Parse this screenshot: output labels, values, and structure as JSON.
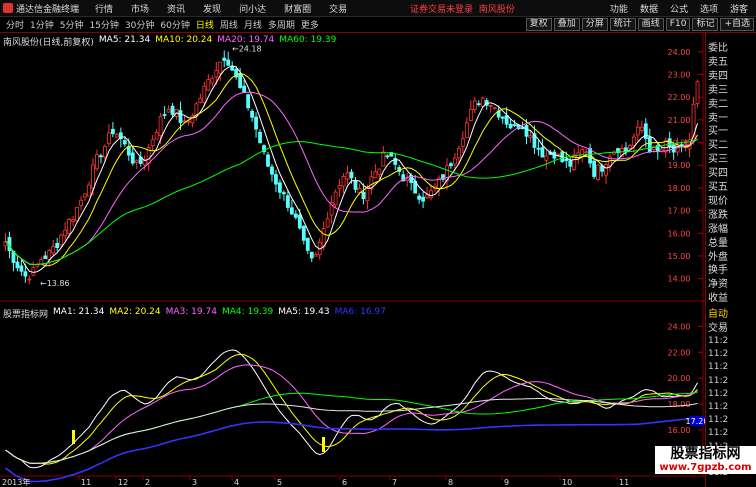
{
  "app": {
    "title": "通达信金融终端"
  },
  "menu": [
    "行情",
    "市场",
    "资讯",
    "发现",
    "问小达",
    "财富圈",
    "交易"
  ],
  "notice": "证券交易未登录",
  "stock_name_top": "南风股份",
  "right_menu": [
    "功能",
    "数据",
    "公式",
    "选项",
    "游客"
  ],
  "periods": [
    {
      "label": "分时",
      "active": false
    },
    {
      "label": "1分钟",
      "active": false
    },
    {
      "label": "5分钟",
      "active": false
    },
    {
      "label": "15分钟",
      "active": false
    },
    {
      "label": "30分钟",
      "active": false
    },
    {
      "label": "60分钟",
      "active": false
    },
    {
      "label": "日线",
      "active": true
    },
    {
      "label": "周线",
      "active": false
    },
    {
      "label": "月线",
      "active": false
    },
    {
      "label": "多周期",
      "active": false
    },
    {
      "label": "更多",
      "active": false
    }
  ],
  "tools": [
    "复权",
    "叠加",
    "分屏",
    "统计",
    "画线",
    "F10",
    "标记",
    "+自选"
  ],
  "main_legend": {
    "stock": "南风股份(日线,前复权)",
    "items": [
      {
        "text": "MA5: 21.34",
        "color": "#ffffff"
      },
      {
        "text": "MA10: 20.24",
        "color": "#ffff00"
      },
      {
        "text": "MA20: 19.74",
        "color": "#ff66ff"
      },
      {
        "text": "MA60: 19.39",
        "color": "#00ff00"
      }
    ]
  },
  "sub_legend": {
    "stock": "股票指标网",
    "items": [
      {
        "text": "MA1: 21.34",
        "color": "#ffffff"
      },
      {
        "text": "MA2: 20.24",
        "color": "#ffff00"
      },
      {
        "text": "MA3: 19.74",
        "color": "#ff66ff"
      },
      {
        "text": "MA4: 19.39",
        "color": "#00ff00"
      },
      {
        "text": "MA5: 19.43",
        "color": "#ffffff"
      },
      {
        "text": "MA6: 16.97",
        "color": "#3333ff"
      }
    ]
  },
  "annotations": {
    "high": "24.18",
    "low": "13.86",
    "marker_label": "17.20"
  },
  "side_labels": [
    "委比",
    "卖五",
    "卖四",
    "卖三",
    "卖二",
    "卖一",
    "买一",
    "买二",
    "买三",
    "买四",
    "买五",
    "现价",
    "涨跌",
    "涨幅",
    "总量",
    "外盘",
    "换手",
    "净资",
    "收益"
  ],
  "side_lower": {
    "header": "自动",
    "sub": "交易",
    "times": [
      "11:2",
      "11:2",
      "11:2",
      "11:2",
      "11:2",
      "11:2",
      "11:2",
      "11:2",
      "11:2",
      "11:2",
      "11:2"
    ]
  },
  "date_axis": {
    "year_label": "2013年",
    "month_labels": [
      "11",
      "12",
      "2",
      "3",
      "4",
      "5",
      "6",
      "7",
      "8",
      "9",
      "10",
      "11"
    ]
  },
  "watermark": {
    "line1": "股票指标网",
    "line2": "www.7gpzb.com"
  },
  "colors": {
    "up": "#ff3232",
    "down": "#54ffff",
    "ma5": "#ffffff",
    "ma10": "#ffff00",
    "ma20": "#ff66ff",
    "ma60": "#00ff00",
    "ma6": "#3333ff",
    "border": "#880000"
  },
  "chart_data": [
    {
      "type": "candlestick",
      "title": "南风股份(日线,前复权)",
      "y_ticks": [
        14.0,
        15.0,
        16.0,
        17.0,
        18.0,
        19.0,
        20.0,
        21.0,
        22.0,
        23.0,
        24.0
      ],
      "ylim": [
        13.5,
        24.3
      ],
      "high": 24.18,
      "low": 13.86,
      "close_path": [
        [
          0,
          16.1
        ],
        [
          8,
          15.2
        ],
        [
          16,
          14.6
        ],
        [
          24,
          14.1
        ],
        [
          32,
          14.3
        ],
        [
          40,
          14.9
        ],
        [
          48,
          15.1
        ],
        [
          56,
          15.6
        ],
        [
          64,
          16.3
        ],
        [
          72,
          16.8
        ],
        [
          80,
          17.5
        ],
        [
          88,
          18.4
        ],
        [
          96,
          19.3
        ],
        [
          104,
          19.9
        ],
        [
          112,
          20.6
        ],
        [
          120,
          20.1
        ],
        [
          128,
          19.5
        ],
        [
          136,
          18.9
        ],
        [
          144,
          19.4
        ],
        [
          152,
          20.3
        ],
        [
          160,
          21.1
        ],
        [
          168,
          21.6
        ],
        [
          176,
          21.2
        ],
        [
          184,
          20.7
        ],
        [
          192,
          21.4
        ],
        [
          200,
          22.1
        ],
        [
          208,
          22.8
        ],
        [
          216,
          23.4
        ],
        [
          224,
          23.9
        ],
        [
          232,
          23.1
        ],
        [
          240,
          22.2
        ],
        [
          248,
          21.5
        ],
        [
          256,
          20.4
        ],
        [
          264,
          19.2
        ],
        [
          272,
          18.5
        ],
        [
          280,
          17.8
        ],
        [
          288,
          17.2
        ],
        [
          296,
          16.4
        ],
        [
          304,
          15.2
        ],
        [
          312,
          14.6
        ],
        [
          320,
          15.8
        ],
        [
          328,
          17.2
        ],
        [
          336,
          18.1
        ],
        [
          344,
          18.7
        ],
        [
          352,
          18.2
        ],
        [
          360,
          17.6
        ],
        [
          368,
          18.3
        ],
        [
          376,
          18.9
        ],
        [
          384,
          19.5
        ],
        [
          392,
          19.1
        ],
        [
          400,
          18.6
        ],
        [
          408,
          18.1
        ],
        [
          416,
          17.8
        ],
        [
          424,
          17.5
        ],
        [
          432,
          17.9
        ],
        [
          440,
          18.4
        ],
        [
          448,
          19.0
        ],
        [
          456,
          19.8
        ],
        [
          464,
          20.7
        ],
        [
          472,
          21.6
        ],
        [
          480,
          22.0
        ],
        [
          488,
          21.8
        ],
        [
          496,
          21.4
        ],
        [
          504,
          21.0
        ],
        [
          512,
          20.6
        ],
        [
          520,
          20.9
        ],
        [
          528,
          20.3
        ],
        [
          536,
          19.8
        ],
        [
          544,
          19.4
        ],
        [
          552,
          19.6
        ],
        [
          560,
          19.2
        ],
        [
          568,
          19.0
        ],
        [
          576,
          19.4
        ],
        [
          584,
          19.8
        ],
        [
          592,
          18.7
        ],
        [
          600,
          18.9
        ],
        [
          608,
          19.5
        ],
        [
          616,
          19.8
        ],
        [
          624,
          19.6
        ],
        [
          632,
          20.2
        ],
        [
          640,
          20.7
        ],
        [
          648,
          19.8
        ],
        [
          656,
          19.5
        ],
        [
          664,
          19.9
        ],
        [
          672,
          19.6
        ],
        [
          680,
          19.7
        ],
        [
          688,
          20.1
        ],
        [
          694,
          22.3
        ],
        [
          700,
          23.0
        ]
      ]
    },
    {
      "type": "line",
      "title": "股票指标网",
      "y_ticks": [
        14.0,
        16.0,
        18.0,
        20.0,
        22.0,
        24.0
      ],
      "ylim": [
        12.6,
        24.8
      ]
    }
  ]
}
